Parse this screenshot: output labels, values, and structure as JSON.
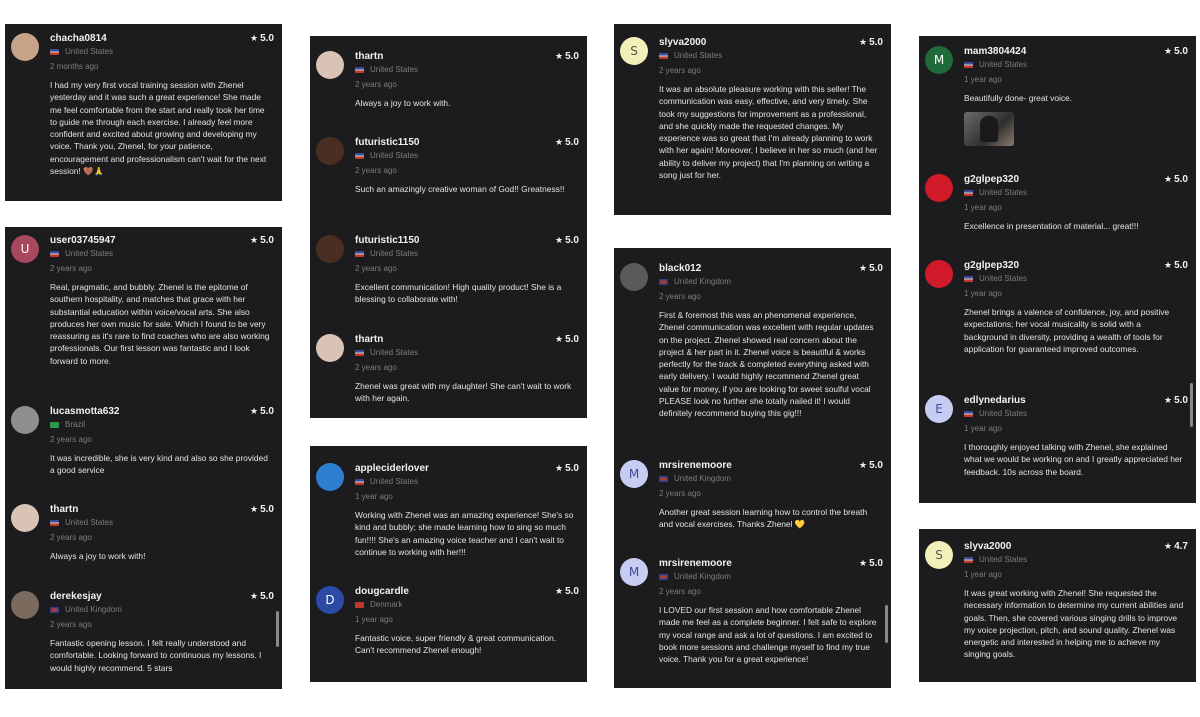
{
  "panels": [
    {
      "reviews": [
        {
          "avatar": "photo",
          "avatar_color": "#c9a28a",
          "name": "chacha0814",
          "rating": "5.0",
          "country": "United States",
          "flag": "us",
          "date": "2 months ago",
          "text": "I had my very first vocal training session with Zhenel yesterday and it was such a great experience! She made me feel comfortable from the start and really took her time to guide me through each exercise. I already feel more confident and excited about growing and developing my voice. Thank you, Zhenel, for your patience, encouragement and professionalism can't wait for the next session! 🤎🙏"
        }
      ]
    },
    {
      "reviews": [
        {
          "avatar": "U",
          "avatar_color": "#a8475e",
          "name": "user03745947",
          "rating": "5.0",
          "country": "United States",
          "flag": "us",
          "date": "2 years ago",
          "text": "Real, pragmatic, and bubbly. Zhenel is the epitome of southern hospitality, and matches that grace with her substantial education within voice/vocal arts. She also produces her own music for sale. Which I found to be very reassuring as it's rare to find coaches who are also working professionals. Our first lesson was fantastic and I look forward to more."
        },
        {
          "avatar": "photo",
          "avatar_color": "#8f8f8f",
          "name": "lucasmotta632",
          "rating": "5.0",
          "country": "Brazil",
          "flag": "br",
          "date": "2 years ago",
          "text": "It was incredible, she is very kind and also so she provided a good service"
        },
        {
          "avatar": "photo",
          "avatar_color": "#d9c3b5",
          "name": "thartn",
          "rating": "5.0",
          "country": "United States",
          "flag": "us",
          "date": "2 years ago",
          "text": "Always a joy to work with!"
        },
        {
          "avatar": "photo",
          "avatar_color": "#7b6a5e",
          "name": "derekesjay",
          "rating": "5.0",
          "country": "United Kingdom",
          "flag": "gb",
          "date": "2 years ago",
          "text": "Fantastic opening lesson. I felt really understood and comfortable. Looking forward to continuous my lessons. I would highly recommend. 5 stars"
        }
      ]
    },
    {
      "reviews": [
        {
          "avatar": "photo",
          "avatar_color": "#d9c3b5",
          "name": "thartn",
          "rating": "5.0",
          "country": "United States",
          "flag": "us",
          "date": "2 years ago",
          "text": "Always a joy to work with."
        },
        {
          "avatar": "photo",
          "avatar_color": "#4a2e22",
          "name": "futuristic1150",
          "rating": "5.0",
          "country": "United States",
          "flag": "us",
          "date": "2 years ago",
          "text": "Such an amazingly creative woman of God!! Greatness!!"
        },
        {
          "avatar": "photo",
          "avatar_color": "#4a2e22",
          "name": "futuristic1150",
          "rating": "5.0",
          "country": "United States",
          "flag": "us",
          "date": "2 years ago",
          "text": "Excellent communication! High quality product! She is a blessing to collaborate with!"
        },
        {
          "avatar": "photo",
          "avatar_color": "#d9c3b5",
          "name": "thartn",
          "rating": "5.0",
          "country": "United States",
          "flag": "us",
          "date": "2 years ago",
          "text": "Zhenel was great with my daughter! She can't wait to work with her again."
        }
      ]
    },
    {
      "reviews": [
        {
          "avatar": "photo",
          "avatar_color": "#2f7fd0",
          "name": "appleciderlover",
          "rating": "5.0",
          "country": "United States",
          "flag": "us",
          "date": "1 year ago",
          "text": "Working with Zhenel was an amazing experience! She's so kind and bubbly; she made learning how to sing so much fun!!!! She's an amazing voice teacher and I can't wait to continue to working with her!!!"
        },
        {
          "avatar": "D",
          "avatar_color": "#2a4aa6",
          "name": "dougcardle",
          "rating": "5.0",
          "country": "Denmark",
          "flag": "dk",
          "date": "1 year ago",
          "text": "Fantastic voice, super friendly & great communication. Can't recommend Zhenel enough!"
        }
      ]
    },
    {
      "reviews": [
        {
          "avatar": "S",
          "avatar_color": "#f2f0b8",
          "avatar_text_color": "#555",
          "name": "slyva2000",
          "rating": "5.0",
          "country": "United States",
          "flag": "us",
          "date": "2 years ago",
          "text": "It was an absolute pleasure working with this seller! The communication was easy, effective, and very timely. She took my suggestions for improvement as a professional, and she quickly made the requested changes. My experience was so great that I'm already planning to work with her again! Moreover, I believe in her so much (and her ability to deliver my project) that I'm planning on writing a song just for her."
        }
      ]
    },
    {
      "reviews": [
        {
          "avatar": "photo",
          "avatar_color": "#5a5a5a",
          "name": "black012",
          "rating": "5.0",
          "country": "United Kingdom",
          "flag": "gb",
          "date": "2 years ago",
          "text": "First & foremost this was an phenomenal experience, Zhenel communication was excellent with regular updates on the project. Zhenel showed real concern about the project & her part in it. Zhenel voice is beautiful & works perfectly for the track & completed everything asked with early delivery. I would highly recommend Zhenel great value for money, if you are looking for sweet soulful vocal PLEASE look no further she totally nailed it! I would definitely recommend buying this gig!!!"
        },
        {
          "avatar": "M",
          "avatar_color": "#c7cdf2",
          "avatar_text_color": "#3b4a9a",
          "name": "mrsirenemoore",
          "rating": "5.0",
          "country": "United Kingdom",
          "flag": "gb",
          "date": "2 years ago",
          "text": "Another great session learning how to control the breath and vocal exercises. Thanks Zhenel 💛"
        },
        {
          "avatar": "M",
          "avatar_color": "#c7cdf2",
          "avatar_text_color": "#3b4a9a",
          "name": "mrsirenemoore",
          "rating": "5.0",
          "country": "United Kingdom",
          "flag": "gb",
          "date": "2 years ago",
          "text": "I LOVED our first session and how comfortable Zhenel made me feel as a complete beginner. I felt safe to explore my vocal range and ask a lot of questions. I am excited to book more sessions and challenge myself to find my true voice. Thank you for a great experience!"
        }
      ]
    },
    {
      "reviews": [
        {
          "avatar": "M",
          "avatar_color": "#1f6b3a",
          "name": "mam3804424",
          "rating": "5.0",
          "country": "United States",
          "flag": "us",
          "date": "1 year ago",
          "text": "Beautifully done- great voice."
        },
        {
          "avatar": "photo",
          "avatar_color": "#d01a2a",
          "name": "g2glpep320",
          "rating": "5.0",
          "country": "United States",
          "flag": "us",
          "date": "1 year ago",
          "text": "Excellence in presentation of material... great!!!"
        },
        {
          "avatar": "photo",
          "avatar_color": "#d01a2a",
          "name": "g2glpep320",
          "rating": "5.0",
          "country": "United States",
          "flag": "us",
          "date": "1 year ago",
          "text": "Zhenel brings a valence of confidence, joy, and positive expectations; her vocal musicality is solid with a background in diversity, providing a wealth of tools for application for guaranteed improved outcomes."
        },
        {
          "avatar": "E",
          "avatar_color": "#c7cdf2",
          "avatar_text_color": "#3b4a9a",
          "name": "edlynedarius",
          "rating": "5.0",
          "country": "United States",
          "flag": "us",
          "date": "1 year ago",
          "text": "I thoroughly enjoyed talking with Zhenel, she explained what we would be working on and I greatly appreciated her feedback. 10s across the board."
        }
      ]
    },
    {
      "reviews": [
        {
          "avatar": "S",
          "avatar_color": "#f2f0b8",
          "avatar_text_color": "#555",
          "name": "slyva2000",
          "rating": "4.7",
          "country": "United States",
          "flag": "us",
          "date": "1 year ago",
          "text": "It was great working with Zhenel! She requested the necessary information to determine my current abilities and goals. Then, she covered various singing drills to improve my voice projection, pitch, and sound quality. Zhenel was energetic and interested in helping me to achieve my singing goals."
        }
      ]
    }
  ]
}
